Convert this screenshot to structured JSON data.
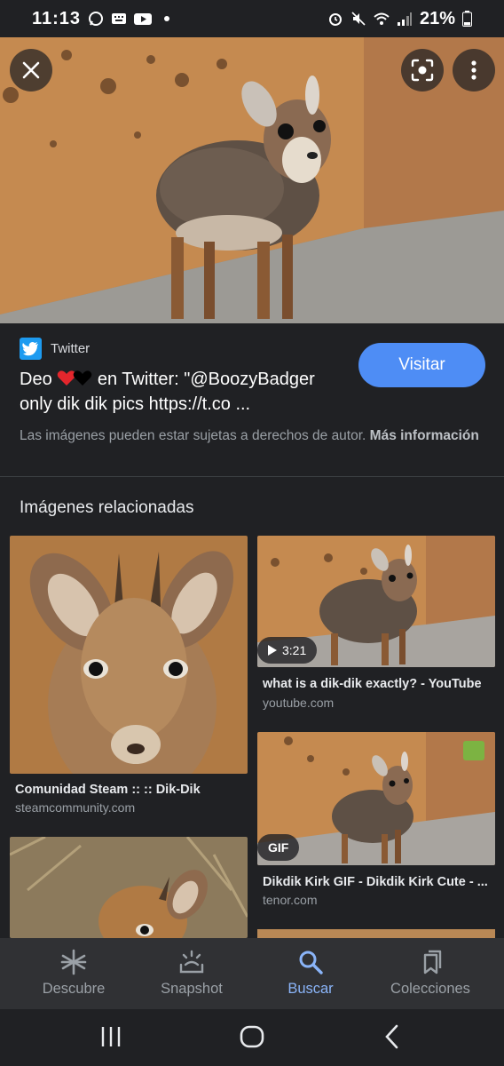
{
  "status_bar": {
    "time": "11:13",
    "battery": "21%"
  },
  "source": {
    "name": "Twitter",
    "visit_label": "Visitar"
  },
  "result": {
    "title_before": "Deo",
    "title_after": "en Twitter: \"@BoozyBadger only dik dik pics https://t.co ...",
    "copyright_text": "Las imágenes pueden estar sujetas a derechos de autor.",
    "more_info": "Más información"
  },
  "related": {
    "heading": "Imágenes relacionadas",
    "items": [
      {
        "title": "Comunidad Steam :: :: Dik-Dik",
        "source": "steamcommunity.com"
      },
      {
        "title": "what is a dik-dik exactly? - YouTube",
        "source": "youtube.com",
        "badge": "3:21"
      },
      {
        "title": "Dikdik Kirk GIF - Dikdik Kirk Cute - ...",
        "source": "tenor.com",
        "badge": "GIF"
      }
    ]
  },
  "bottom_nav": {
    "items": [
      {
        "label": "Descubre",
        "icon": "asterisk-icon"
      },
      {
        "label": "Snapshot",
        "icon": "snapshot-icon"
      },
      {
        "label": "Buscar",
        "icon": "search-icon",
        "active": true
      },
      {
        "label": "Colecciones",
        "icon": "collections-icon"
      }
    ]
  },
  "colors": {
    "accent": "#8ab4f8",
    "visit_button": "#4e8df5",
    "background": "#202124"
  }
}
